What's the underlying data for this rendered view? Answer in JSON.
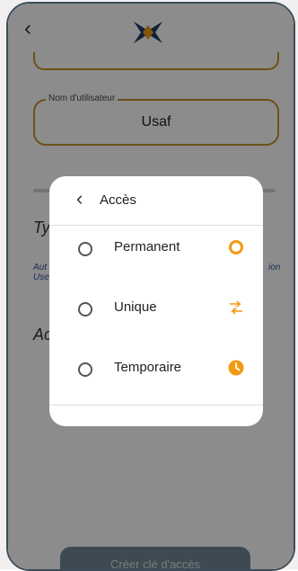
{
  "header": {
    "back_icon": "chevron-left-icon",
    "logo": "app-logo-x"
  },
  "form": {
    "username_label": "Nom d'utilisateur",
    "username_value": "Usaf",
    "type_label_partial": "Ty",
    "aut_partial_line1": "Aut",
    "aut_partial_line2": "Use",
    "ion_partial": "ion",
    "acces_label_partial": "Ac",
    "create_button": "Créer clé d'accès"
  },
  "modal": {
    "title": "Accès",
    "back_icon": "chevron-left-icon",
    "options": [
      {
        "label": "Permanent",
        "icon": "ring-icon",
        "selected": false
      },
      {
        "label": "Unique",
        "icon": "single-use-icon",
        "selected": false
      },
      {
        "label": "Temporaire",
        "icon": "clock-icon",
        "selected": false
      }
    ]
  },
  "colors": {
    "accent": "#f29a14",
    "field_border": "#c9922b",
    "frame": "#3b4b58",
    "button": "#6f8796"
  }
}
